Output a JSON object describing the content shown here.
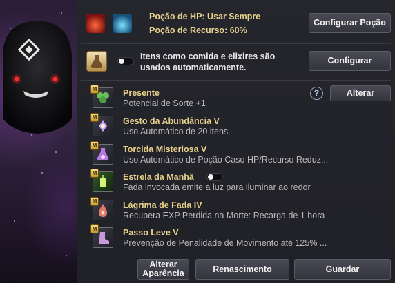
{
  "potions": {
    "hp_line": "Poção de HP: Usar Sempre",
    "resource_line": "Poção de Recurso: 60%",
    "configure_button": "Configurar Poção",
    "hp_icon": "red-potion-icon",
    "resource_icon": "blue-potion-icon"
  },
  "auto_items": {
    "text_line1": "Itens como comida e elixires são",
    "text_line2": "usados automaticamente.",
    "configure_button": "Configurar",
    "icon": "elixir-flask-icon",
    "toggle_on": false
  },
  "skills_header": {
    "help_label": "?",
    "change_button": "Alterar"
  },
  "skills": [
    {
      "badge": "M",
      "title": "Presente",
      "desc": "Potencial de Sorte +1",
      "icon": "clover-icon"
    },
    {
      "badge": "M",
      "title": "Gesto da Abundância V",
      "desc": "Uso Automático de 20 itens.",
      "icon": "fairy-icon"
    },
    {
      "badge": "M",
      "title": "Torcida Misteriosa V",
      "desc": "Uso Automático de Poção Caso HP/Recurso Reduz...",
      "icon": "potion-flask-icon"
    },
    {
      "badge": "M",
      "title": "Estrela da Manhã",
      "desc": "Fada invocada emite a luz para iluminar ao redor",
      "icon": "lantern-icon",
      "toggle_on": false
    },
    {
      "badge": "M",
      "title": "Lágrima de Fada IV",
      "desc": "Recupera EXP Perdida na Morte: Recarga de 1 hora",
      "icon": "fairy-tear-icon"
    },
    {
      "badge": "M",
      "title": "Passo Leve V",
      "desc": "Prevenção de Penalidade de Movimento até 125% ...",
      "icon": "boot-icon"
    }
  ],
  "footer": {
    "appearance_line1": "Alterar",
    "appearance_line2": "Aparência",
    "rebirth_button": "Renascimento",
    "save_button": "Guardar"
  },
  "colors": {
    "title_gold": "#e8d18a",
    "panel_bg": "#23232a",
    "description_gray": "#b9b9b9"
  }
}
